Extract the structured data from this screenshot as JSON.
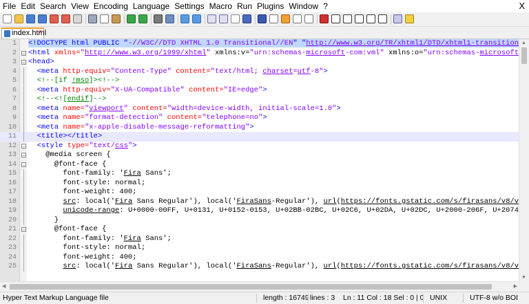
{
  "menu": [
    "File",
    "Edit",
    "Search",
    "View",
    "Encoding",
    "Language",
    "Settings",
    "Macro",
    "Run",
    "Plugins",
    "Window",
    "?"
  ],
  "window_close": "X",
  "toolbar_icons": [
    {
      "name": "new-file-icon",
      "color": "#ffffff",
      "border": "#888"
    },
    {
      "name": "open-file-icon",
      "color": "#f2c44c",
      "border": "#b08a20"
    },
    {
      "name": "save-icon",
      "color": "#4a7fd0",
      "border": "#2a5aa0"
    },
    {
      "name": "save-all-icon",
      "color": "#4a7fd0",
      "border": "#2a5aa0"
    },
    {
      "name": "close-icon",
      "color": "#e06050",
      "border": "#a03020"
    },
    {
      "name": "close-all-icon",
      "color": "#e06050",
      "border": "#a03020"
    },
    {
      "name": "print-icon",
      "color": "#d8d8d8",
      "border": "#777"
    },
    {
      "sep": true
    },
    {
      "name": "cut-icon",
      "color": "#9aa9bd",
      "border": "#556"
    },
    {
      "name": "copy-icon",
      "color": "#ffffff",
      "border": "#777"
    },
    {
      "name": "paste-icon",
      "color": "#c99a55",
      "border": "#7a5a20"
    },
    {
      "sep": true
    },
    {
      "name": "undo-icon",
      "color": "#3aa84a",
      "border": "#1a7030"
    },
    {
      "name": "redo-icon",
      "color": "#3aa84a",
      "border": "#1a7030"
    },
    {
      "sep": true
    },
    {
      "name": "find-icon",
      "color": "#7a7a7a",
      "border": "#444"
    },
    {
      "name": "replace-icon",
      "color": "#6e8fc0",
      "border": "#3a5a90"
    },
    {
      "sep": true
    },
    {
      "name": "zoom-in-icon",
      "color": "#5a9ae0",
      "border": "#2a6ab0"
    },
    {
      "name": "zoom-out-icon",
      "color": "#5a9ae0",
      "border": "#2a6ab0"
    },
    {
      "sep": true
    },
    {
      "name": "sync-vertical-icon",
      "color": "#e0e0f0",
      "border": "#6a6aa0"
    },
    {
      "name": "sync-horizontal-icon",
      "color": "#e0e0f0",
      "border": "#6a6aa0"
    },
    {
      "name": "word-wrap-icon",
      "color": "#ffffff",
      "border": "#888"
    },
    {
      "name": "show-all-chars-icon",
      "color": "#4a6ac0",
      "border": "#2a3a80"
    },
    {
      "sep": true
    },
    {
      "name": "indent-guide-icon",
      "color": "#3a5ab0",
      "border": "#1a2a70"
    },
    {
      "name": "user-language-icon",
      "color": "#ffffff",
      "border": "#777"
    },
    {
      "name": "doc-map-icon",
      "color": "#f0a030",
      "border": "#a06010"
    },
    {
      "name": "function-list-icon",
      "color": "#ffffff",
      "border": "#777"
    },
    {
      "name": "folder-workspace-icon",
      "color": "#ffffff",
      "border": "#777"
    },
    {
      "sep": true
    },
    {
      "name": "monitoring-icon",
      "color": "#d03030",
      "border": "#801010"
    },
    {
      "name": "record-macro-icon",
      "color": "#ffffff",
      "border": "#333"
    },
    {
      "name": "stop-macro-icon",
      "color": "#ffffff",
      "border": "#333"
    },
    {
      "name": "play-macro-icon",
      "color": "#ffffff",
      "border": "#333"
    },
    {
      "name": "play-multiple-macro-icon",
      "color": "#ffffff",
      "border": "#333"
    },
    {
      "name": "save-macro-icon",
      "color": "#ffffff",
      "border": "#333"
    },
    {
      "sep": true
    },
    {
      "name": "spell-check-icon",
      "color": "#c8c8e8",
      "border": "#6060a0"
    },
    {
      "name": "plugin-icon",
      "color": "#f0d040",
      "border": "#a08010"
    }
  ],
  "tab": {
    "label": "index.html",
    "close": "x"
  },
  "colors": {
    "tag": "#0000ff",
    "attr": "#ff0000",
    "value": "#8000ff",
    "comment": "#008000",
    "prop": "#000000",
    "selection": "#c0d8ff",
    "current_line": "#e8e8ff",
    "tab_accent": "#f0a030"
  },
  "lines": [
    {
      "n": "1",
      "fold": "none",
      "current": false,
      "parts": [
        {
          "t": "<!DOCTYPE html PUBLIC \"",
          "c": "tag",
          "sel": true
        },
        {
          "t": "-//W3C//DTD XHTML 1.0 Transitional//EN",
          "c": "value",
          "sel": true
        },
        {
          "t": "\" \"",
          "c": "tag",
          "sel": true
        },
        {
          "t": "http://www.w3.org/TR/xhtml1/DTD/xhtml1-transition",
          "c": "value",
          "sel": true,
          "u": true
        }
      ]
    },
    {
      "n": "2",
      "fold": "box",
      "current": false,
      "parts": [
        {
          "t": "<html ",
          "c": "tag"
        },
        {
          "t": "xmlns=",
          "c": "attr"
        },
        {
          "t": "\"",
          "c": "value"
        },
        {
          "t": "http://www.w3.org/1999/xhtml",
          "c": "value",
          "u": true
        },
        {
          "t": "\" ",
          "c": "value"
        },
        {
          "t": "xmlns:v=",
          "c": "prop"
        },
        {
          "t": "\"urn:schemas-",
          "c": "value"
        },
        {
          "t": "microsoft",
          "c": "value",
          "u": true
        },
        {
          "t": "-com:vml\" ",
          "c": "value"
        },
        {
          "t": "xmlns:o=",
          "c": "prop"
        },
        {
          "t": "\"urn:schemas-",
          "c": "value"
        },
        {
          "t": "microsoft",
          "c": "value",
          "u": true
        }
      ]
    },
    {
      "n": "3",
      "fold": "box",
      "current": false,
      "parts": [
        {
          "t": "<head>",
          "c": "tag"
        }
      ]
    },
    {
      "n": "4",
      "fold": "bar",
      "current": false,
      "parts": [
        {
          "t": "  <meta ",
          "c": "tag"
        },
        {
          "t": "http-equiv=",
          "c": "attr"
        },
        {
          "t": "\"Content-Type\" ",
          "c": "value"
        },
        {
          "t": "content=",
          "c": "attr"
        },
        {
          "t": "\"text/html; ",
          "c": "value"
        },
        {
          "t": "charset",
          "c": "value",
          "u": true
        },
        {
          "t": "=",
          "c": "value"
        },
        {
          "t": "utf",
          "c": "value",
          "u": true
        },
        {
          "t": "-8\"",
          "c": "value"
        },
        {
          "t": ">",
          "c": "tag"
        }
      ]
    },
    {
      "n": "5",
      "fold": "bar",
      "current": false,
      "parts": [
        {
          "t": "  <!--[if ",
          "c": "comment"
        },
        {
          "t": "!mso",
          "c": "comment",
          "u": true
        },
        {
          "t": "]><!-->",
          "c": "comment"
        }
      ]
    },
    {
      "n": "6",
      "fold": "bar",
      "current": false,
      "parts": [
        {
          "t": "  <meta ",
          "c": "tag"
        },
        {
          "t": "http-equiv=",
          "c": "attr"
        },
        {
          "t": "\"X-UA-Compatible\" ",
          "c": "value"
        },
        {
          "t": "content=",
          "c": "attr"
        },
        {
          "t": "\"IE=edge\"",
          "c": "value"
        },
        {
          "t": ">",
          "c": "tag"
        }
      ]
    },
    {
      "n": "7",
      "fold": "bar",
      "current": false,
      "parts": [
        {
          "t": "  <!--<![",
          "c": "comment"
        },
        {
          "t": "endif",
          "c": "comment",
          "u": true
        },
        {
          "t": "]-->",
          "c": "comment"
        }
      ]
    },
    {
      "n": "8",
      "fold": "bar",
      "current": false,
      "parts": [
        {
          "t": "  <meta ",
          "c": "tag"
        },
        {
          "t": "name=",
          "c": "attr"
        },
        {
          "t": "\"",
          "c": "value"
        },
        {
          "t": "viewport",
          "c": "value",
          "u": true
        },
        {
          "t": "\" ",
          "c": "value"
        },
        {
          "t": "content=",
          "c": "attr"
        },
        {
          "t": "\"width=device-width, initial-scale=1.0\"",
          "c": "value"
        },
        {
          "t": ">",
          "c": "tag"
        }
      ]
    },
    {
      "n": "9",
      "fold": "bar",
      "current": false,
      "parts": [
        {
          "t": "  <meta ",
          "c": "tag"
        },
        {
          "t": "name=",
          "c": "attr"
        },
        {
          "t": "\"format-detection\" ",
          "c": "value"
        },
        {
          "t": "content=",
          "c": "attr"
        },
        {
          "t": "\"telephone=no\"",
          "c": "value"
        },
        {
          "t": ">",
          "c": "tag"
        }
      ]
    },
    {
      "n": "10",
      "fold": "bar",
      "current": false,
      "parts": [
        {
          "t": "  <meta ",
          "c": "tag"
        },
        {
          "t": "name=",
          "c": "attr"
        },
        {
          "t": "\"x-apple-disable-message-reformatting\"",
          "c": "value"
        },
        {
          "t": ">",
          "c": "tag"
        }
      ]
    },
    {
      "n": "11",
      "fold": "bar",
      "current": true,
      "parts": [
        {
          "t": "  <title></title>",
          "c": "tag"
        }
      ]
    },
    {
      "n": "12",
      "fold": "box",
      "current": false,
      "parts": [
        {
          "t": "  <style ",
          "c": "tag"
        },
        {
          "t": "type=",
          "c": "attr"
        },
        {
          "t": "\"text/",
          "c": "value"
        },
        {
          "t": "css",
          "c": "value",
          "u": true
        },
        {
          "t": "\"",
          "c": "value"
        },
        {
          "t": ">",
          "c": "tag"
        }
      ]
    },
    {
      "n": "13",
      "fold": "box",
      "current": false,
      "parts": [
        {
          "t": "    @media screen {",
          "c": "prop"
        }
      ]
    },
    {
      "n": "14",
      "fold": "box",
      "current": false,
      "parts": [
        {
          "t": "      @font-face {",
          "c": "prop"
        }
      ]
    },
    {
      "n": "15",
      "fold": "bar",
      "current": false,
      "parts": [
        {
          "t": "        font-family: '",
          "c": "prop"
        },
        {
          "t": "Fira",
          "c": "prop",
          "u": true
        },
        {
          "t": " Sans';",
          "c": "prop"
        }
      ]
    },
    {
      "n": "16",
      "fold": "bar",
      "current": false,
      "parts": [
        {
          "t": "        font-style: normal;",
          "c": "prop"
        }
      ]
    },
    {
      "n": "17",
      "fold": "bar",
      "current": false,
      "parts": [
        {
          "t": "        font-weight: 400;",
          "c": "prop"
        }
      ]
    },
    {
      "n": "18",
      "fold": "bar",
      "current": false,
      "parts": [
        {
          "t": "        ",
          "c": "prop"
        },
        {
          "t": "src",
          "c": "prop",
          "u": true
        },
        {
          "t": ": local('",
          "c": "prop"
        },
        {
          "t": "Fira",
          "c": "prop",
          "u": true
        },
        {
          "t": " Sans Regular'), local('",
          "c": "prop"
        },
        {
          "t": "FiraSans",
          "c": "prop",
          "u": true
        },
        {
          "t": "-Regular'), ",
          "c": "prop"
        },
        {
          "t": "url",
          "c": "prop",
          "u": true
        },
        {
          "t": "(",
          "c": "prop"
        },
        {
          "t": "https://fonts.gstatic.com/s/firasans/v8/v",
          "c": "prop",
          "u": true
        }
      ]
    },
    {
      "n": "19",
      "fold": "bar",
      "current": false,
      "parts": [
        {
          "t": "        ",
          "c": "prop"
        },
        {
          "t": "unicode-range",
          "c": "prop",
          "u": true
        },
        {
          "t": ": U+0000-00FF, U+0131, U+0152-0153, U+02BB-02BC, U+02C6, U+02DA, U+02DC, U+2000-206F, U+2074",
          "c": "prop"
        }
      ]
    },
    {
      "n": "20",
      "fold": "bar",
      "current": false,
      "parts": [
        {
          "t": "      }",
          "c": "prop"
        }
      ]
    },
    {
      "n": "21",
      "fold": "box",
      "current": false,
      "parts": [
        {
          "t": "      @font-face {",
          "c": "prop"
        }
      ]
    },
    {
      "n": "22",
      "fold": "bar",
      "current": false,
      "parts": [
        {
          "t": "        font-family: '",
          "c": "prop"
        },
        {
          "t": "Fira",
          "c": "prop",
          "u": true
        },
        {
          "t": " Sans';",
          "c": "prop"
        }
      ]
    },
    {
      "n": "23",
      "fold": "bar",
      "current": false,
      "parts": [
        {
          "t": "        font-style: normal;",
          "c": "prop"
        }
      ]
    },
    {
      "n": "24",
      "fold": "bar",
      "current": false,
      "parts": [
        {
          "t": "        font-weight: 400;",
          "c": "prop"
        }
      ]
    },
    {
      "n": "25",
      "fold": "bar",
      "current": false,
      "parts": [
        {
          "t": "        ",
          "c": "prop"
        },
        {
          "t": "src",
          "c": "prop",
          "u": true
        },
        {
          "t": ": local('",
          "c": "prop"
        },
        {
          "t": "Fira",
          "c": "prop",
          "u": true
        },
        {
          "t": " Sans Regular'), local('",
          "c": "prop"
        },
        {
          "t": "FiraSans",
          "c": "prop",
          "u": true
        },
        {
          "t": "-Regular'), ",
          "c": "prop"
        },
        {
          "t": "url",
          "c": "prop",
          "u": true
        },
        {
          "t": "(",
          "c": "prop"
        },
        {
          "t": "https://fonts.gstatic.com/s/firasans/v8/v",
          "c": "prop",
          "u": true
        }
      ]
    }
  ],
  "status": {
    "language": "Hyper Text Markup Language file",
    "length": "length : 16749",
    "lines": "lines : 3",
    "position": "Ln : 11    Col : 18    Sel : 0 | 0",
    "eol": "UNIX",
    "encoding": "UTF-8 w/o BOI"
  }
}
